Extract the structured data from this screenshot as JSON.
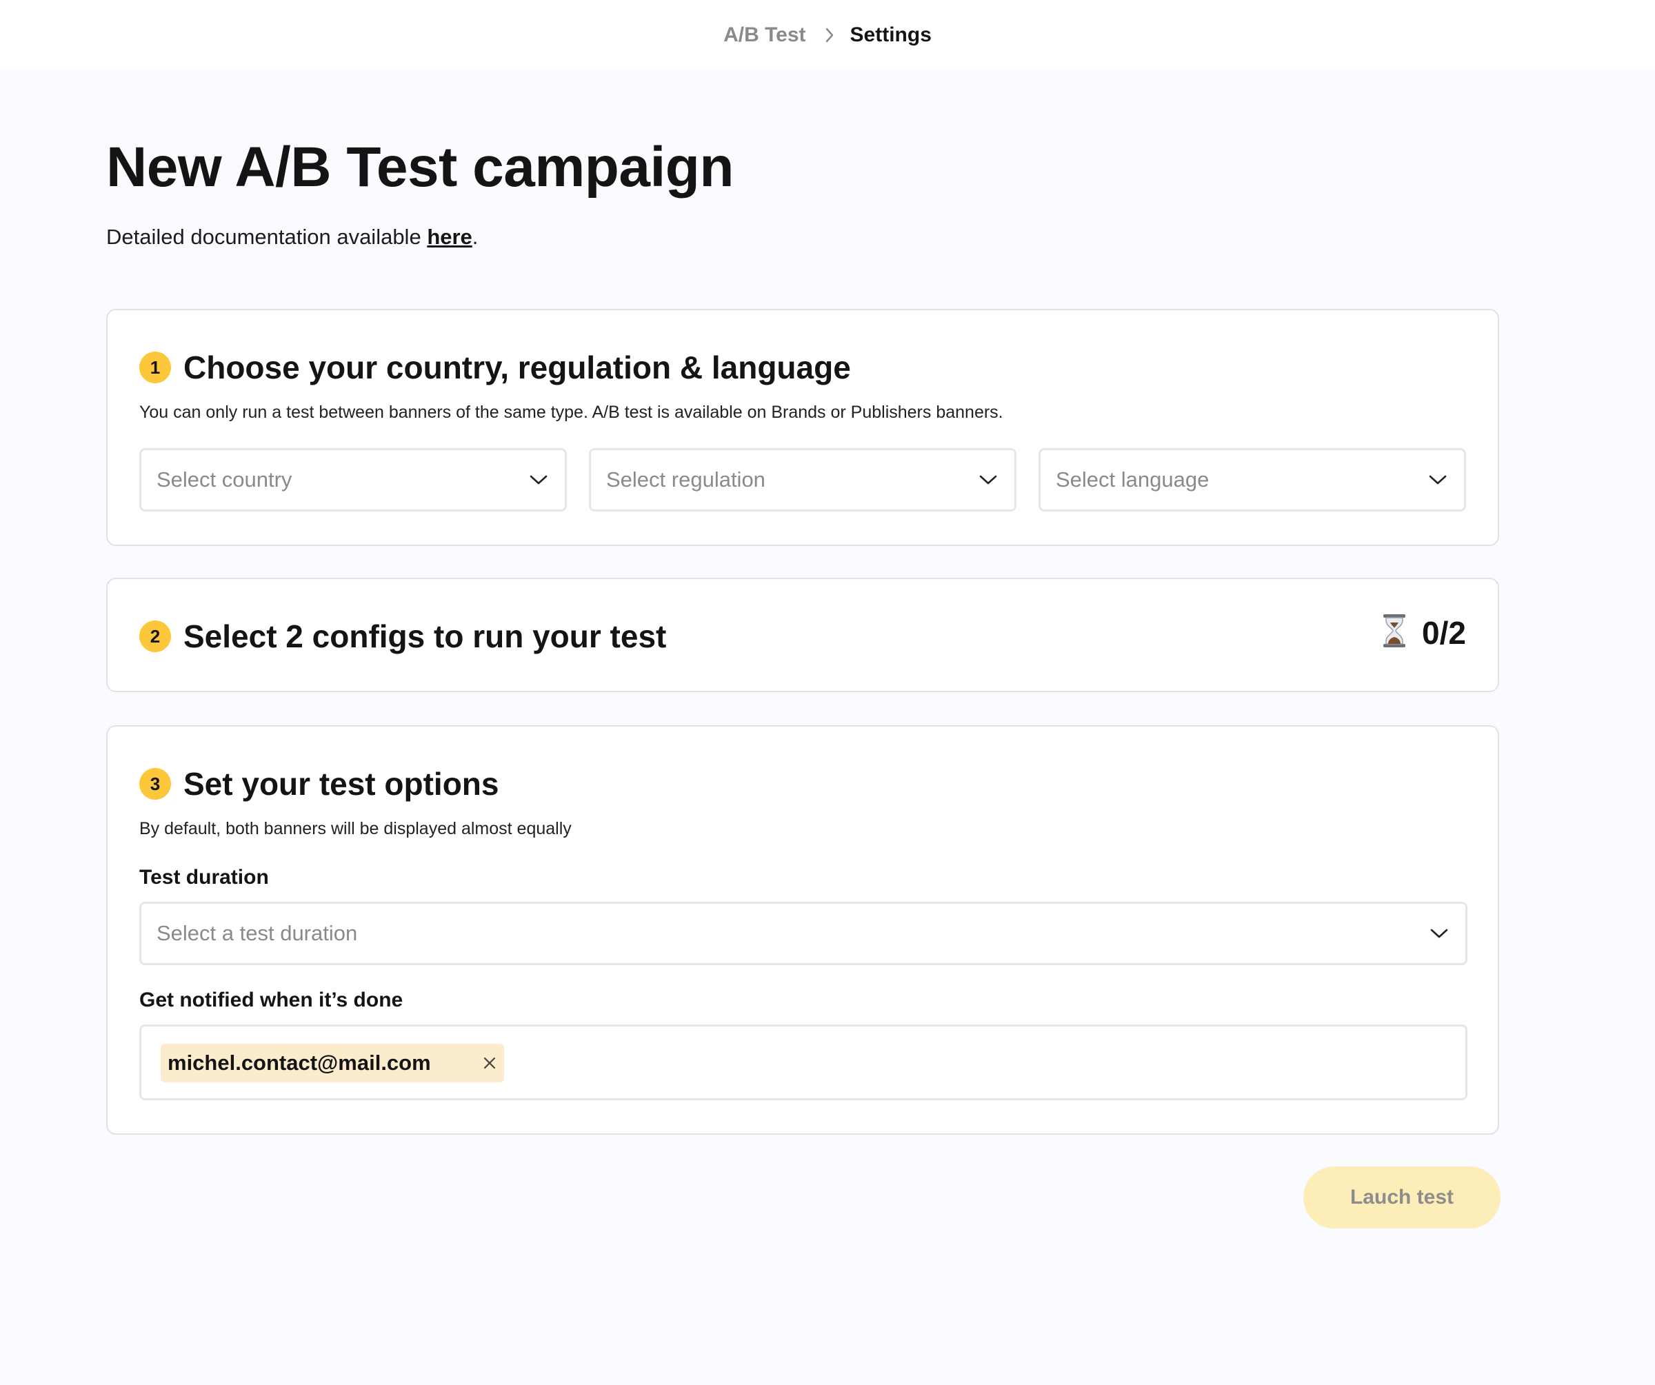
{
  "breadcrumb": {
    "parent": "A/B Test",
    "current": "Settings"
  },
  "header": {
    "title": "New A/B Test campaign",
    "doc_prefix": "Detailed documentation available ",
    "doc_link": "here",
    "doc_suffix": "."
  },
  "step1": {
    "number": "1",
    "title": "Choose your country, regulation & language",
    "description": "You can only run a test between banners of the same type. A/B test is available on Brands or Publishers banners.",
    "country_placeholder": "Select country",
    "regulation_placeholder": "Select regulation",
    "language_placeholder": "Select language"
  },
  "step2": {
    "number": "2",
    "title": "Select 2 configs to run your test",
    "counter": "0/2"
  },
  "step3": {
    "number": "3",
    "title": "Set your test options",
    "description": "By default, both banners will be displayed almost equally",
    "duration_label": "Test duration",
    "duration_placeholder": "Select a test duration",
    "notify_label": "Get notified when it’s done",
    "emails": [
      "michel.contact@mail.com"
    ]
  },
  "actions": {
    "launch_label": "Lauch test"
  },
  "colors": {
    "accent": "#fcc73a",
    "chip_bg": "#faeccd",
    "button_disabled_bg": "#fdedb8",
    "page_bg": "#fafbfe"
  }
}
